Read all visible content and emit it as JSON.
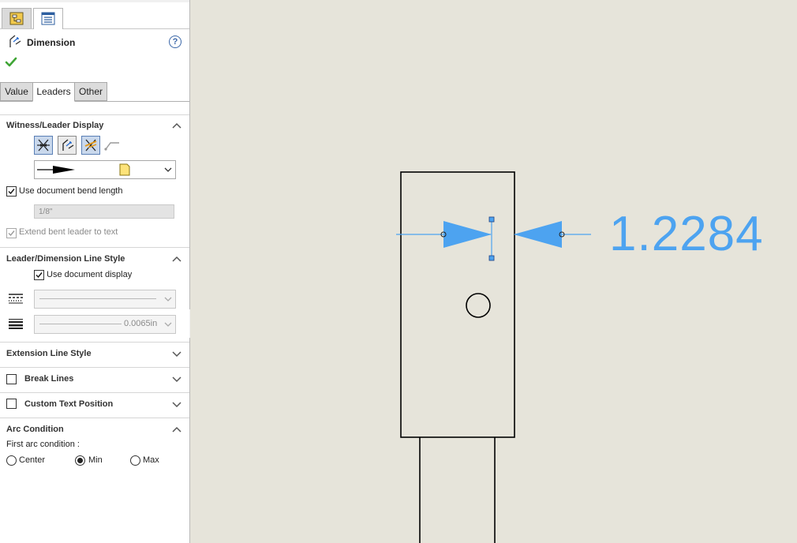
{
  "panel": {
    "title": "Dimension",
    "tabs": [
      "Value",
      "Leaders",
      "Other"
    ],
    "active_tab": "Leaders",
    "witness": {
      "header": "Witness/Leader Display",
      "use_doc_bend_label": "Use document bend length",
      "use_doc_bend_checked": true,
      "bend_length": "1/8\"",
      "extend_bent_label": "Extend bent leader to text",
      "extend_bent_checked": true
    },
    "leader_style": {
      "header": "Leader/Dimension Line Style",
      "use_doc_display_label": "Use document display",
      "use_doc_display_checked": true,
      "thickness_value": "0.0065in"
    },
    "extension_line": {
      "header": "Extension Line Style"
    },
    "break_lines": {
      "header": "Break Lines",
      "checked": false
    },
    "custom_text": {
      "header": "Custom Text Position",
      "checked": false
    },
    "arc": {
      "header": "Arc Condition",
      "first_label": "First arc condition :",
      "options": [
        "Center",
        "Min",
        "Max"
      ],
      "selected": "Min"
    }
  },
  "canvas": {
    "dimension_value": "1.2284",
    "dimension_color": "#4da3f0",
    "geometry_color": "#000000",
    "background_color": "#e6e4da"
  }
}
